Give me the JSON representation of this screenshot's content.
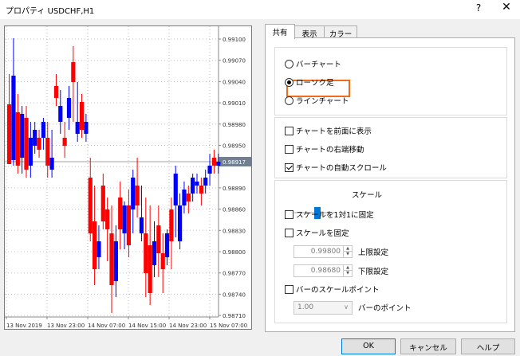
{
  "window": {
    "title": "プロパティ USDCHF,H1",
    "help_label": "?",
    "close_label": "✕"
  },
  "chart": {
    "price_labels": [
      "0.99100",
      "0.99070",
      "0.99040",
      "0.99010",
      "0.98980",
      "0.98950",
      "0.98890",
      "0.98860",
      "0.98830",
      "0.98800",
      "0.98770",
      "0.98740",
      "0.98710"
    ],
    "current_price": "0.98917",
    "time_labels": [
      "13 Nov 2019",
      "13 Nov 23:00",
      "14 Nov 07:00",
      "14 Nov 15:00",
      "14 Nov 23:00",
      "15 Nov 07:00"
    ],
    "colors": {
      "bull": "#0000ff",
      "bear": "#ff0000",
      "grid": "#c0c0c0",
      "price_tag_bg": "#708090"
    }
  },
  "tabs": [
    {
      "label": "共有"
    },
    {
      "label": "表示"
    },
    {
      "label": "カラー"
    }
  ],
  "chart_type": {
    "bar_label": "バーチャート",
    "candle_label": "ローソク足",
    "line_label": "ラインチャート",
    "selected": "ローソク足"
  },
  "options": {
    "foreground_label": "チャートを前面に表示",
    "foreground_checked": false,
    "shift_label": "チャートの右端移動",
    "shift_checked": false,
    "autoscroll_label": "チャートの自動スクロール",
    "autoscroll_checked": true
  },
  "scale": {
    "slider_label": "スケール",
    "fix_1to1_label": "スケールを1対1に固定",
    "fix_1to1_checked": false,
    "fix_label": "スケールを固定",
    "fix_checked": false,
    "upper_value": "0.99800",
    "upper_label": "上限設定",
    "lower_value": "0.98680",
    "lower_label": "下限設定",
    "bar_scale_label": "バーのスケールポイント",
    "bar_scale_checked": false,
    "bar_points_value": "1.00",
    "bar_points_label": "バーのポイント"
  },
  "buttons": {
    "ok": "OK",
    "cancel": "キャンセル",
    "help": "ヘルプ"
  }
}
